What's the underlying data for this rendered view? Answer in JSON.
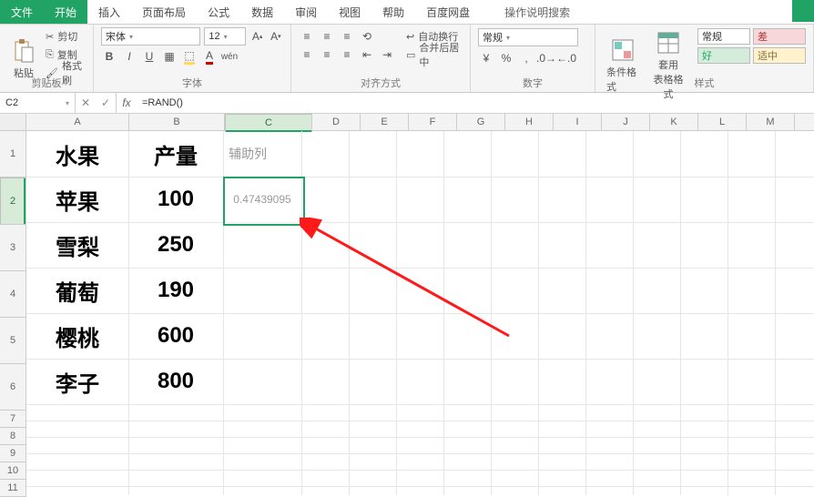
{
  "menu": {
    "file": "文件",
    "tabs": [
      "开始",
      "插入",
      "页面布局",
      "公式",
      "数据",
      "审阅",
      "视图",
      "帮助",
      "百度网盘"
    ],
    "active_tab": 0,
    "search_hint": "操作说明搜索"
  },
  "ribbon": {
    "clipboard": {
      "label": "剪贴板",
      "paste": "粘贴",
      "cut": "剪切",
      "copy": "复制",
      "painter": "格式刷"
    },
    "font": {
      "label": "字体",
      "name": "宋体",
      "size": "12",
      "buttons": [
        "B",
        "I",
        "U"
      ]
    },
    "align": {
      "label": "对齐方式",
      "wrap": "自动换行",
      "merge": "合并后居中"
    },
    "number": {
      "label": "数字",
      "format": "常规"
    },
    "styles": {
      "label": "样式",
      "cond": "条件格式",
      "table": "套用\n表格格式",
      "normal": "常规",
      "bad": "差",
      "good": "好",
      "neutral": "适中"
    }
  },
  "namebox": "C2",
  "formula": "=RAND()",
  "columns": [
    "A",
    "B",
    "C",
    "D",
    "E",
    "F",
    "G",
    "H",
    "I",
    "J",
    "K",
    "L",
    "M"
  ],
  "row_headers_tall": [
    1,
    2,
    3,
    4,
    5,
    6
  ],
  "row_headers_small": [
    7,
    8,
    9,
    10,
    11
  ],
  "sheet": {
    "A1": "水果",
    "B1": "产量",
    "C1": "辅助列",
    "A2": "苹果",
    "B2": "100",
    "C2": "0.47439095",
    "A3": "雪梨",
    "B3": "250",
    "A4": "葡萄",
    "B4": "190",
    "A5": "樱桃",
    "B5": "600",
    "A6": "李子",
    "B6": "800"
  },
  "active_cell": "C2"
}
